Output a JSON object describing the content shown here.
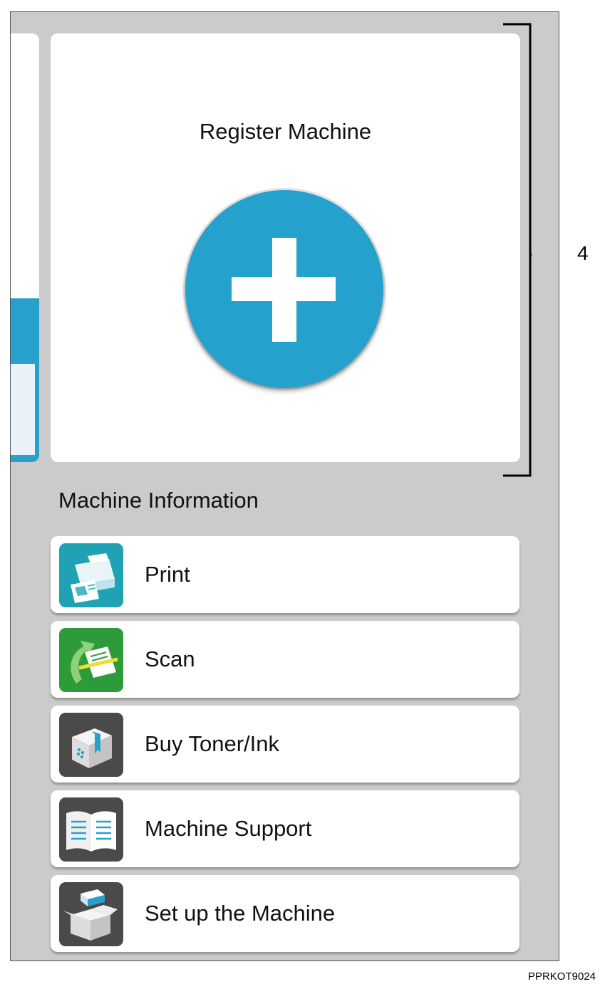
{
  "register": {
    "title": "Register Machine"
  },
  "machine_info": {
    "title": "Machine Information",
    "items": [
      {
        "label": "Print",
        "icon": "printer-icon"
      },
      {
        "label": "Scan",
        "icon": "scanner-icon"
      },
      {
        "label": "Buy Toner/Ink",
        "icon": "toner-box-icon"
      },
      {
        "label": "Machine Support",
        "icon": "manual-book-icon"
      },
      {
        "label": "Set up the Machine",
        "icon": "setup-box-icon"
      }
    ]
  },
  "callout": {
    "number": "4"
  },
  "figure_code": "PPRKOT9024",
  "colors": {
    "accent": "#24a1cc",
    "background": "#cbcbcb",
    "scan_green": "#2e9b3a",
    "dark_icon": "#4a4a4a"
  }
}
